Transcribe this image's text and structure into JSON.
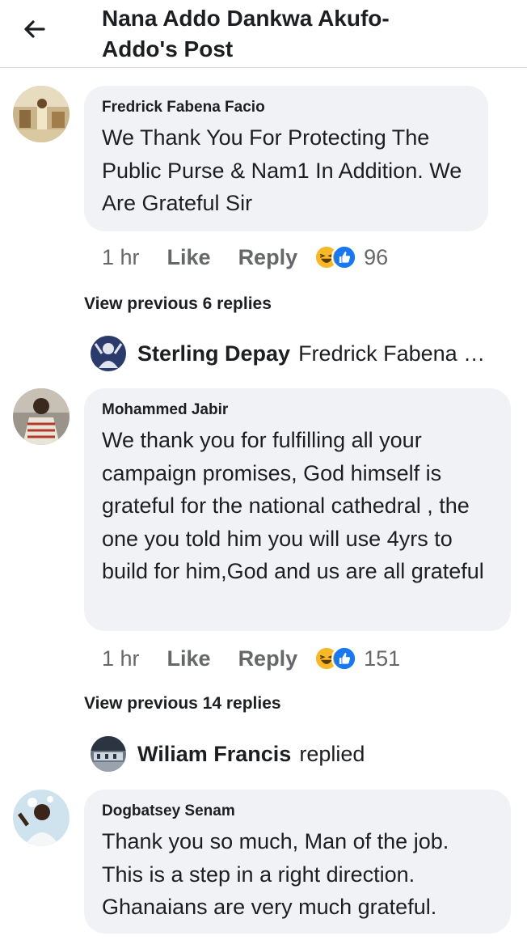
{
  "header": {
    "title": "Nana Addo Dankwa Akufo-Addo's Post",
    "back_icon": "back-arrow-icon"
  },
  "comments": [
    {
      "author": "Fredrick Fabena Facio",
      "text": "We Thank You For Protecting The Public Purse & Nam1 In Addition. We Are Grateful Sir",
      "time": "1 hr",
      "like_label": "Like",
      "reply_label": "Reply",
      "reaction_count": "96",
      "reaction_icons": [
        "haha-icon",
        "like-icon"
      ]
    },
    {
      "author": "Mohammed Jabir",
      "text": "We thank you for fulfilling all your campaign promises, God himself is grateful for the national cathedral , the one you told him you will use 4yrs to build for him,God and us are all grateful",
      "time": "1 hr",
      "like_label": "Like",
      "reply_label": "Reply",
      "reaction_count": "151",
      "reaction_icons": [
        "haha-icon",
        "like-icon"
      ]
    },
    {
      "author": "Dogbatsey Senam",
      "text": "Thank you so much, Man of the job. This is a step in a right direction. Ghanaians are very much grateful."
    }
  ],
  "threads": [
    {
      "view_previous": "View previous 6 replies",
      "reply_name": "Sterling Depay",
      "reply_snippet": "Fredrick Fabena Facio"
    },
    {
      "view_previous": "View previous 14 replies",
      "reply_name": "Wiliam Francis",
      "reply_snippet": "replied"
    }
  ],
  "colors": {
    "bubble": "#f0f2f5",
    "meta": "#65676b",
    "text": "#1c1e21",
    "like_blue": "#1877f2",
    "haha_yellow": "#f7b928"
  }
}
